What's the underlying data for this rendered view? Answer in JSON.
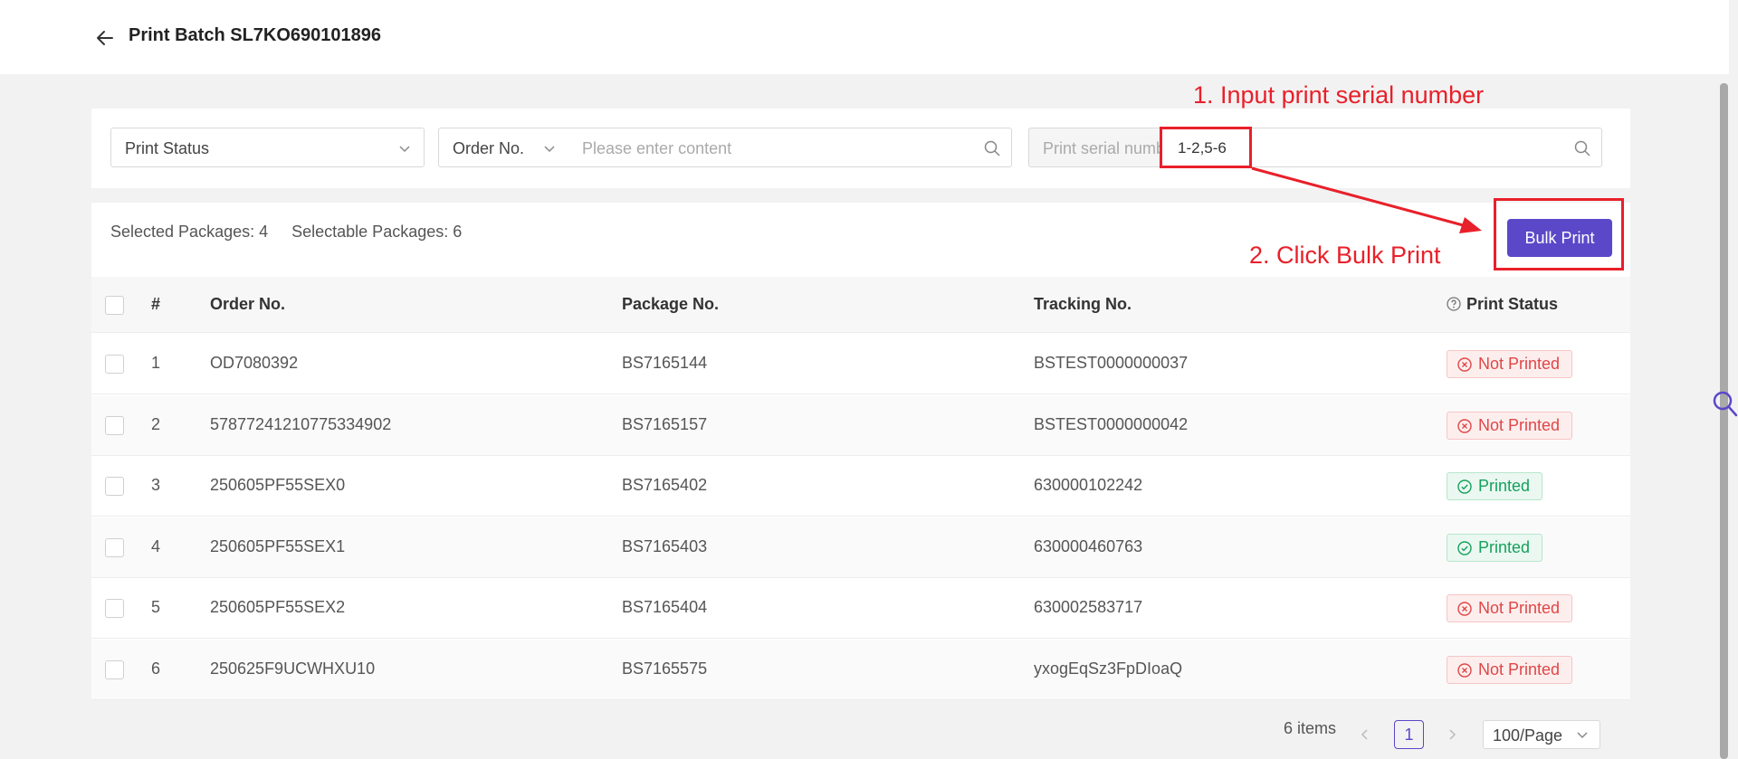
{
  "header": {
    "title": "Print Batch SL7KO690101896"
  },
  "filters": {
    "print_status_placeholder": "Print Status",
    "order_field_label": "Order No.",
    "order_search_placeholder": "Please enter content",
    "serial_label": "Print serial number",
    "serial_value": "1-2,5-6"
  },
  "summary": {
    "selected": "Selected Packages: 4",
    "selectable": "Selectable Packages: 6",
    "bulk_print_label": "Bulk Print"
  },
  "table": {
    "columns": [
      "#",
      "Order No.",
      "Package No.",
      "Tracking No.",
      "Print Status"
    ],
    "rows": [
      {
        "index": "1",
        "order": "OD7080392",
        "package": "BS7165144",
        "tracking": "BSTEST0000000037",
        "status": "Not Printed"
      },
      {
        "index": "2",
        "order": "57877241210775334902",
        "package": "BS7165157",
        "tracking": "BSTEST0000000042",
        "status": "Not Printed"
      },
      {
        "index": "3",
        "order": "250605PF55SEX0",
        "package": "BS7165402",
        "tracking": "630000102242",
        "status": "Printed"
      },
      {
        "index": "4",
        "order": "250605PF55SEX1",
        "package": "BS7165403",
        "tracking": "630000460763",
        "status": "Printed"
      },
      {
        "index": "5",
        "order": "250605PF55SEX2",
        "package": "BS7165404",
        "tracking": "630002583717",
        "status": "Not Printed"
      },
      {
        "index": "6",
        "order": "250625F9UCWHXU10",
        "package": "BS7165575",
        "tracking": "yxogEqSz3FpDIoaQ",
        "status": "Not Printed"
      }
    ]
  },
  "pagination": {
    "total": "6 items",
    "current_page": "1",
    "page_size": "100/Page"
  },
  "annotations": {
    "step1": "1. Input print serial number",
    "step2": "2. Click Bulk Print"
  },
  "colors": {
    "accent": "#5a48c8",
    "annotation": "#e8202a",
    "not_printed": "#e04646",
    "printed": "#17a05d"
  }
}
